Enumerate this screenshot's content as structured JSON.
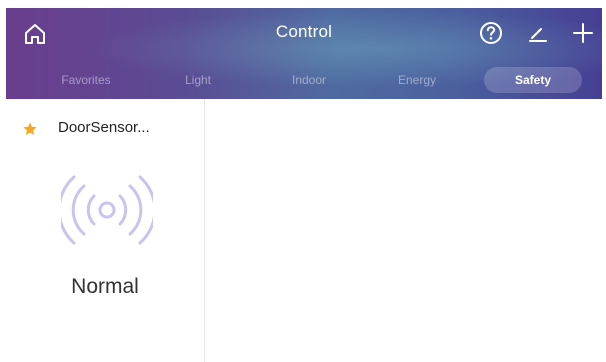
{
  "header": {
    "title": "Control",
    "home_icon": "home-icon",
    "help_icon": "help-icon",
    "edit_icon": "edit-icon",
    "add_icon": "plus-icon"
  },
  "tabs": [
    {
      "label": "Favorites",
      "active": false
    },
    {
      "label": "Light",
      "active": false
    },
    {
      "label": "Indoor",
      "active": false
    },
    {
      "label": "Energy",
      "active": false
    },
    {
      "label": "Safety",
      "active": true
    }
  ],
  "device_card": {
    "name": "DoorSensor...",
    "favorite_icon": "star-icon",
    "favorite_color": "#f5a623",
    "sensor_icon": "signal-waves-icon",
    "sensor_icon_color": "#c9c3ef",
    "status": "Normal"
  }
}
